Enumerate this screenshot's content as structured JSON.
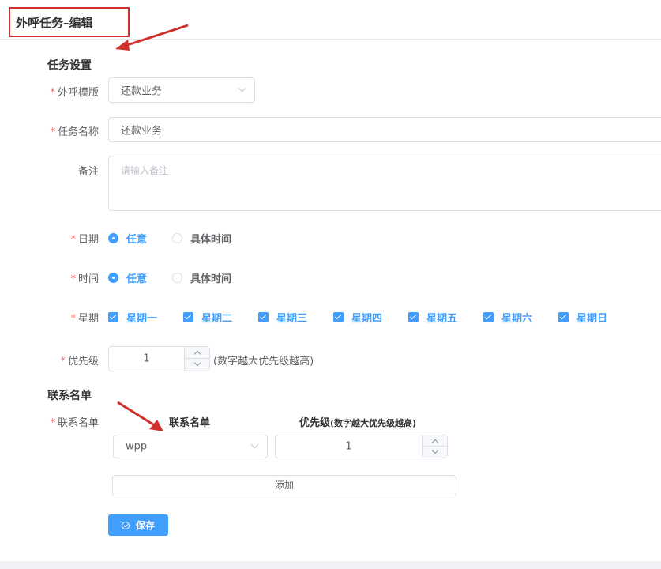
{
  "header": {
    "title": "外呼任务–编辑"
  },
  "task_settings": {
    "section_title": "任务设置",
    "template": {
      "label": "外呼模版",
      "value": "还款业务"
    },
    "task_name": {
      "label": "任务名称",
      "value": "还款业务"
    },
    "remark": {
      "label": "备注",
      "placeholder": "请输入备注"
    },
    "date": {
      "label": "日期",
      "options": [
        "任意",
        "具体时间"
      ],
      "selected": "任意"
    },
    "time": {
      "label": "时间",
      "options": [
        "任意",
        "具体时间"
      ],
      "selected": "任意"
    },
    "weekday": {
      "label": "星期",
      "options": [
        "星期一",
        "星期二",
        "星期三",
        "星期四",
        "星期五",
        "星期六",
        "星期日"
      ],
      "checked": [
        "星期一",
        "星期二",
        "星期三",
        "星期四",
        "星期五",
        "星期六",
        "星期日"
      ]
    },
    "priority": {
      "label": "优先级",
      "value": "1",
      "hint": "(数字越大优先级越高)"
    }
  },
  "contact_list": {
    "section_title": "联系名单",
    "label": "联系名单",
    "col_list": "联系名单",
    "col_priority_main": "优先级",
    "col_priority_note": "(数字越大优先级越高)",
    "row": {
      "list_value": "wpp",
      "priority_value": "1"
    },
    "add_label": "添加"
  },
  "actions": {
    "save_label": "保存"
  },
  "colors": {
    "primary": "#409eff",
    "required": "#f56c6c",
    "annotation": "#d0302c"
  },
  "icons": {
    "save": "check-circle-icon",
    "dropdown": "chevron-down-icon",
    "step_up": "chevron-up-icon",
    "step_down": "chevron-down-icon"
  }
}
